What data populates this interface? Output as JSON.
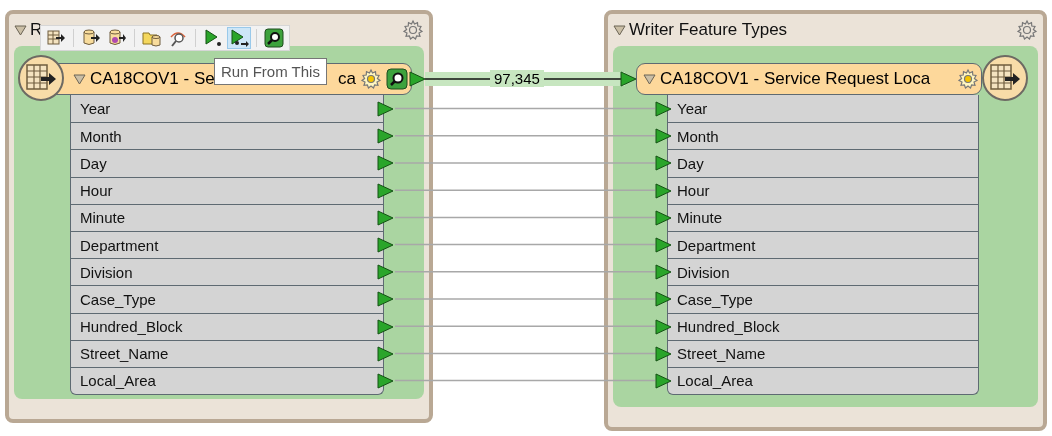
{
  "reader": {
    "title": "R",
    "feature": {
      "name": "CA18COV1 - Se",
      "name_tail": "ca",
      "expanded": true
    },
    "attributes": [
      "Year",
      "Month",
      "Day",
      "Hour",
      "Minute",
      "Department",
      "Division",
      "Case_Type",
      "Hundred_Block",
      "Street_Name",
      "Local_Area"
    ]
  },
  "toolbar": {
    "groups": [
      [
        {
          "kind": "table-out",
          "selected": false
        }
      ],
      [
        {
          "kind": "db-out",
          "selected": false
        },
        {
          "kind": "db-gear-out",
          "selected": false
        }
      ],
      [
        {
          "kind": "folder-db",
          "selected": false
        },
        {
          "kind": "inspect",
          "selected": false
        }
      ],
      [
        {
          "kind": "run",
          "selected": false
        },
        {
          "kind": "run-from",
          "selected": true
        }
      ],
      [
        {
          "kind": "magnifier",
          "selected": false
        }
      ]
    ],
    "tooltip": "Run From This"
  },
  "connection": {
    "count": "97,345"
  },
  "writer": {
    "title": "Writer Feature Types",
    "feature": {
      "name": "CA18COV1 - Service Request Loca",
      "expanded": true
    },
    "attributes": [
      "Year",
      "Month",
      "Day",
      "Hour",
      "Minute",
      "Department",
      "Division",
      "Case_Type",
      "Hundred_Block",
      "Street_Name",
      "Local_Area"
    ]
  }
}
